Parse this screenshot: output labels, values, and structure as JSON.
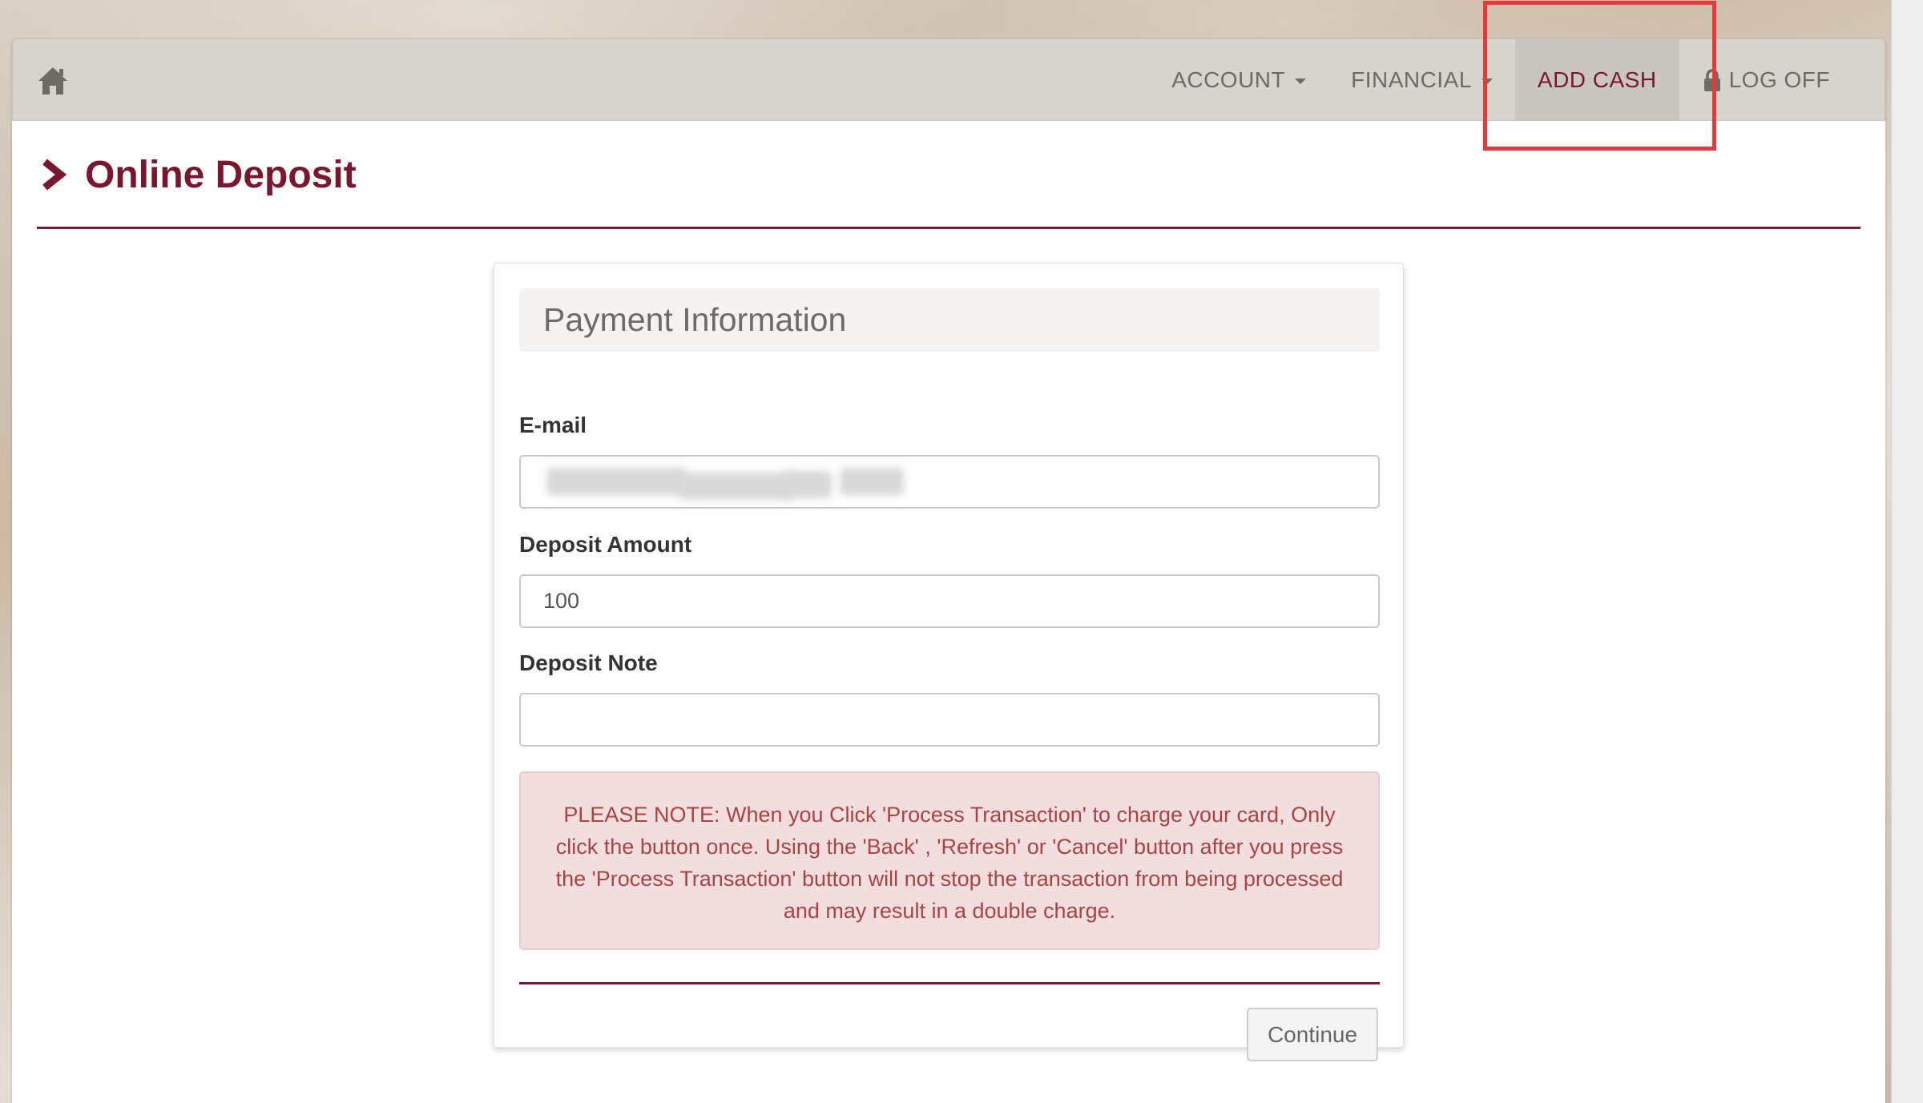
{
  "nav": {
    "home_icon": "home-icon",
    "items": [
      {
        "label": "ACCOUNT",
        "has_dropdown": true
      },
      {
        "label": "FINANCIAL",
        "has_dropdown": true
      },
      {
        "label": "ADD CASH",
        "active": true
      },
      {
        "label": "LOG OFF",
        "icon": "lock-icon"
      }
    ]
  },
  "page": {
    "title": "Online Deposit",
    "title_icon": "chevron-right-icon"
  },
  "form": {
    "header": "Payment Information",
    "email": {
      "label": "E-mail",
      "value": "",
      "redacted": true
    },
    "deposit_amount": {
      "label": "Deposit Amount",
      "value": "100"
    },
    "deposit_note": {
      "label": "Deposit Note",
      "value": ""
    },
    "notice": "PLEASE NOTE: When you Click 'Process Transaction' to charge your card, Only click the button once. Using the 'Back' , 'Refresh' or 'Cancel' button after you press the 'Process Transaction' button will not stop the transaction from being processed and may result in a double charge.",
    "continue_label": "Continue"
  },
  "colors": {
    "brand": "#7a1631",
    "alert_bg": "#f2dede",
    "alert_text": "#a94442",
    "highlight": "#e8393a"
  }
}
